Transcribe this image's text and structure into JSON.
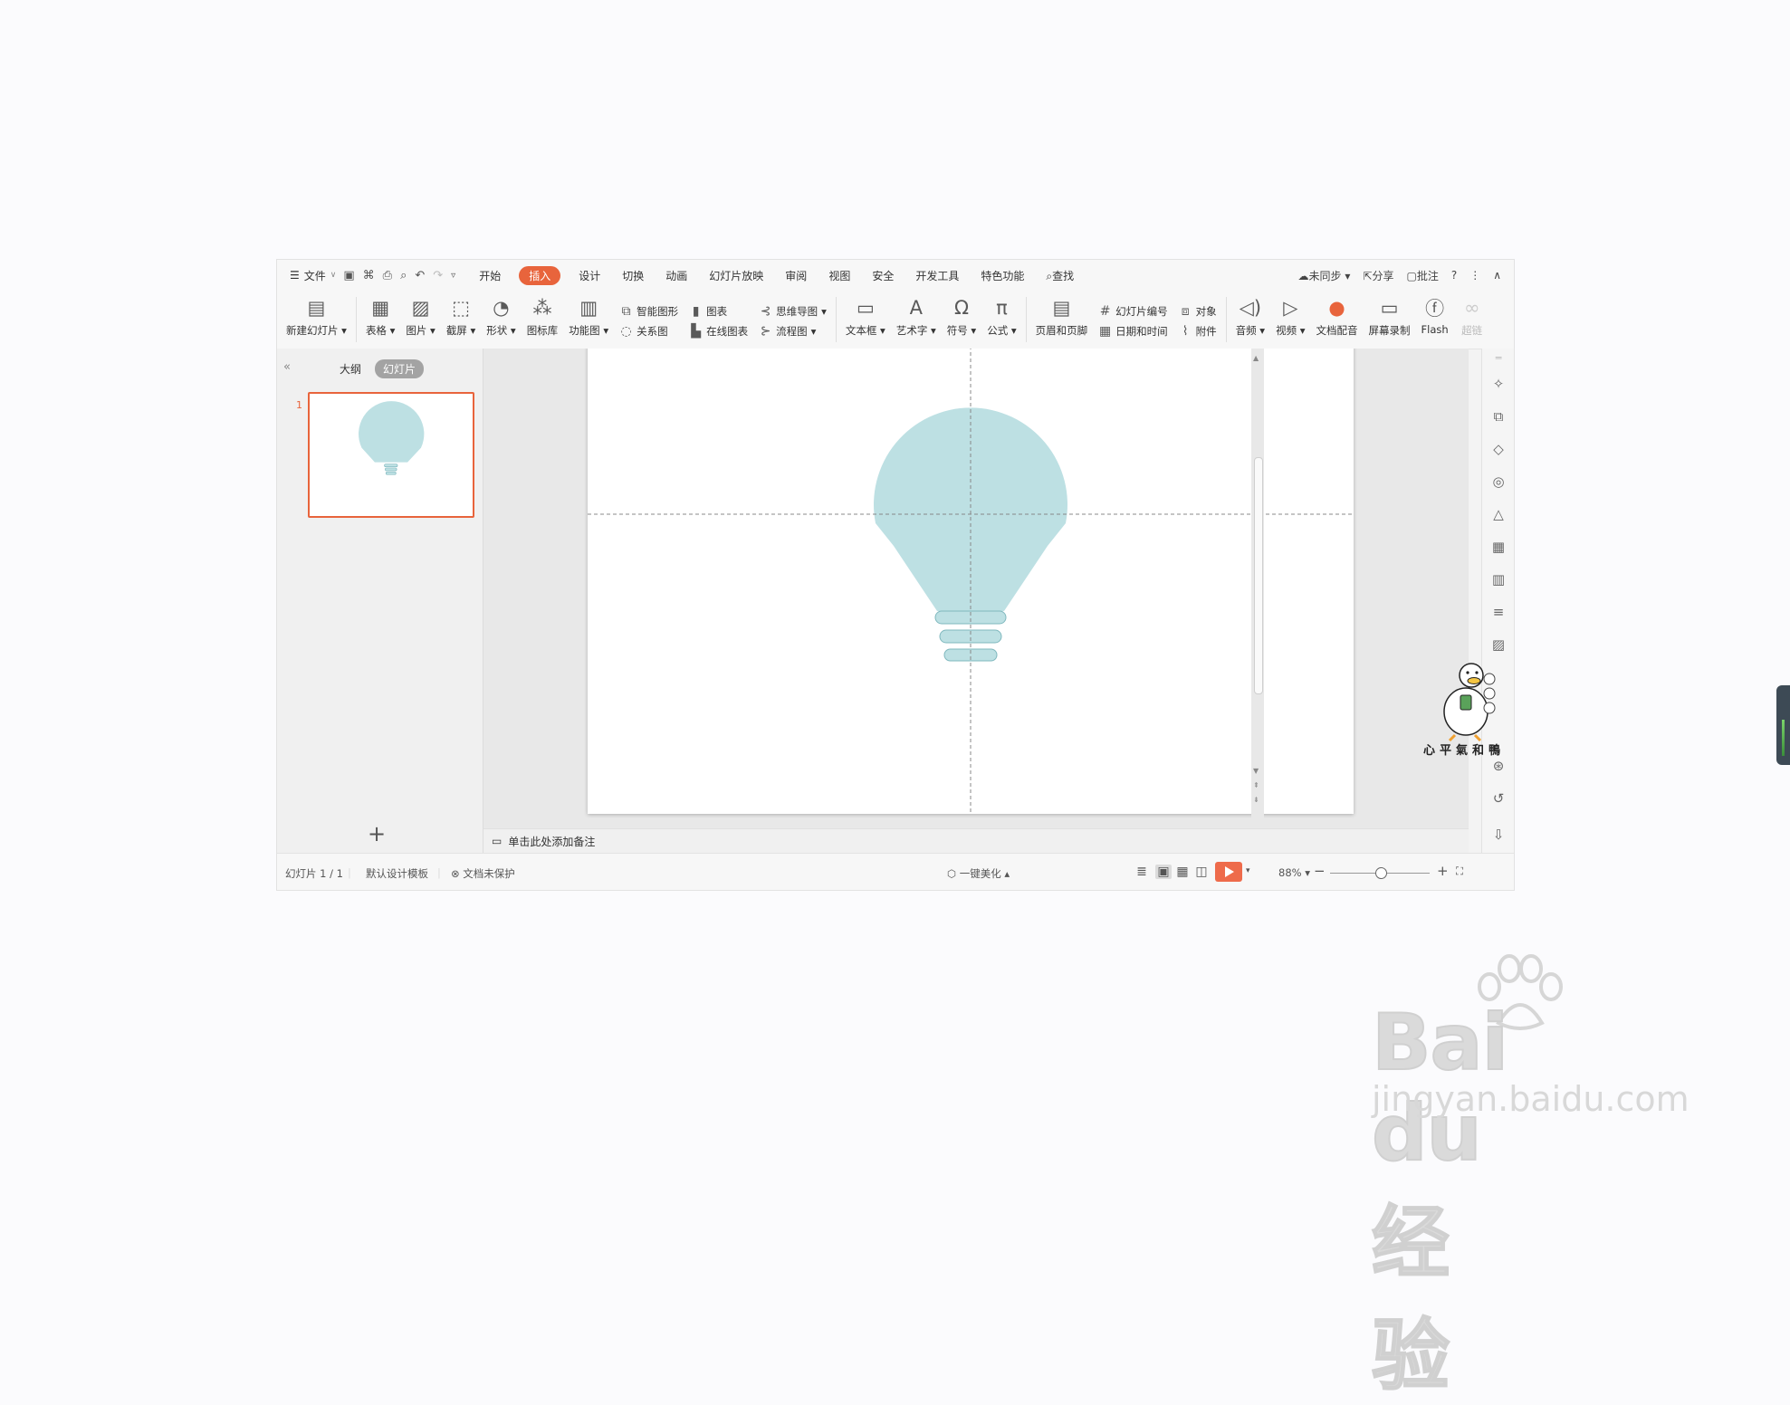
{
  "menubar": {
    "file": "文件",
    "tabs": [
      "开始",
      "插入",
      "设计",
      "切换",
      "动画",
      "幻灯片放映",
      "审阅",
      "视图",
      "安全",
      "开发工具",
      "特色功能"
    ],
    "active_tab": "插入",
    "search": "查找",
    "sync": "未同步",
    "share": "分享",
    "comment": "批注",
    "help": "?"
  },
  "ribbon": {
    "new_slide": "新建幻灯片",
    "table": "表格",
    "picture": "图片",
    "screenshot": "截屏",
    "shape": "形状",
    "icon_lib": "图标库",
    "func_chart": "功能图",
    "smart_art": "智能图形",
    "chart": "图表",
    "mind_map": "思维导图",
    "relation": "关系图",
    "online_chart": "在线图表",
    "flowchart": "流程图",
    "textbox": "文本框",
    "art_text": "艺术字",
    "symbol": "符号",
    "formula": "公式",
    "header_footer": "页眉和页脚",
    "slide_number": "幻灯片编号",
    "object": "对象",
    "date_time": "日期和时间",
    "attachment": "附件",
    "audio": "音频",
    "video": "视频",
    "doc_dub": "文档配音",
    "screen_rec": "屏幕录制",
    "flash": "Flash",
    "hyperlink": "超链"
  },
  "leftpanel": {
    "tab_outline": "大纲",
    "tab_slides": "幻灯片",
    "slide_number": "1"
  },
  "notes": {
    "placeholder": "单击此处添加备注"
  },
  "status": {
    "slide_info": "幻灯片 1 / 1",
    "template": "默认设计模板",
    "protection": "文档未保护",
    "beautify": "一键美化",
    "zoom": "88%"
  },
  "mascot_text": "心平氣和鴨",
  "watermark": {
    "main": "Bai du 经验",
    "sub": "jingyan.baidu.com"
  },
  "colors": {
    "accent": "#e8643c",
    "bulb": "#bde0e3",
    "bulb_stroke": "#7fb8be"
  }
}
